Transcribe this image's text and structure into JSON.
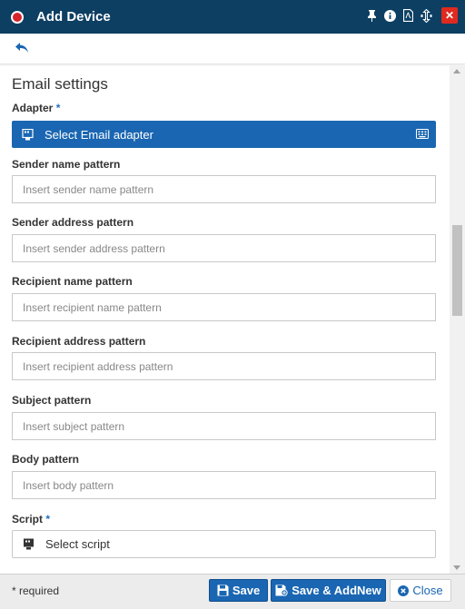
{
  "window": {
    "title": "Add Device",
    "close_label": "✕"
  },
  "form": {
    "section_title": "Email settings",
    "adapter": {
      "label": "Adapter",
      "required_mark": "*",
      "value": "Select Email adapter"
    },
    "sender_name": {
      "label": "Sender name pattern",
      "placeholder": "Insert sender name pattern"
    },
    "sender_address": {
      "label": "Sender address pattern",
      "placeholder": "Insert sender address pattern"
    },
    "recipient_name": {
      "label": "Recipient name pattern",
      "placeholder": "Insert recipient name pattern"
    },
    "recipient_address": {
      "label": "Recipient address pattern",
      "placeholder": "Insert recipient address pattern"
    },
    "subject": {
      "label": "Subject pattern",
      "placeholder": "Insert subject pattern"
    },
    "body": {
      "label": "Body pattern",
      "placeholder": "Insert body pattern"
    },
    "script": {
      "label": "Script",
      "required_mark": "*",
      "value": "Select script"
    }
  },
  "footer": {
    "required_note": "* required",
    "save_label": "Save",
    "save_addnew_label": "Save & AddNew",
    "close_label": "Close"
  },
  "colors": {
    "header": "#0d3f63",
    "primary": "#1a66b2",
    "danger": "#e0291f"
  },
  "icons": {
    "record": "record-dot-icon",
    "pin": "pin-icon",
    "info": "info-icon",
    "pdf": "pdf-icon",
    "resize": "resize-icon",
    "back": "back-arrow-icon",
    "adapter": "adapter-icon",
    "keyboard": "keyboard-icon",
    "script": "script-icon",
    "save": "floppy-disk-icon",
    "close": "times-circle-icon"
  }
}
